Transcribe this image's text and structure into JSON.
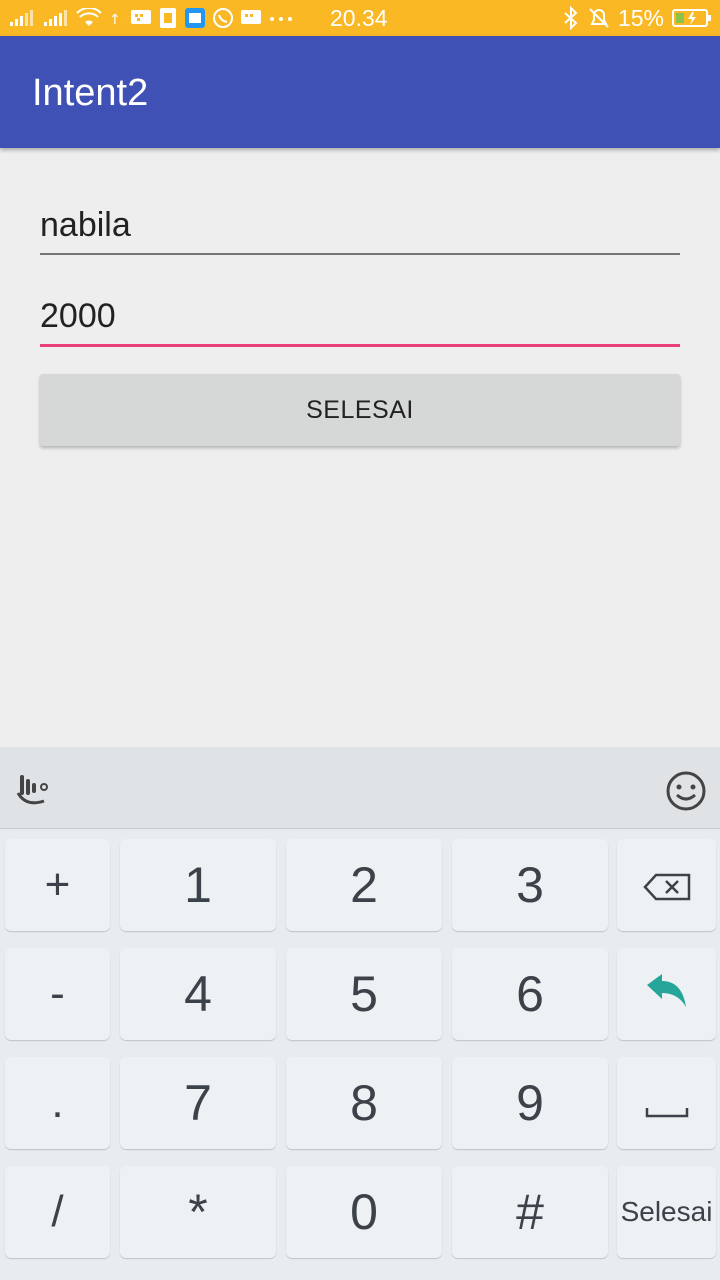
{
  "status_bar": {
    "time": "20.34",
    "battery_percent": "15%",
    "icons": [
      "signal-1-icon",
      "signal-2-icon",
      "wifi-icon",
      "data-icon",
      "bbm-icon",
      "notification-icon",
      "message-icon",
      "whatsapp-icon",
      "bbm-2-icon",
      "more-icon",
      "bluetooth-icon",
      "alarm-off-icon",
      "battery-icon"
    ]
  },
  "app_bar": {
    "title": "Intent2"
  },
  "form": {
    "name_value": "nabila",
    "number_value": "2000",
    "button_label": "SELESAI"
  },
  "keyboard": {
    "rows": [
      [
        "+",
        "1",
        "2",
        "3",
        "⌫"
      ],
      [
        "-",
        "4",
        "5",
        "6",
        "↩"
      ],
      [
        ".",
        "7",
        "8",
        "9",
        "␣"
      ],
      [
        "/",
        "*",
        "0",
        "#",
        "Selesai"
      ]
    ],
    "accent_color": "#26a69a"
  },
  "colors": {
    "status_bar": "#f9b824",
    "app_bar": "#3f51b5",
    "focus_underline": "#ec407a"
  }
}
